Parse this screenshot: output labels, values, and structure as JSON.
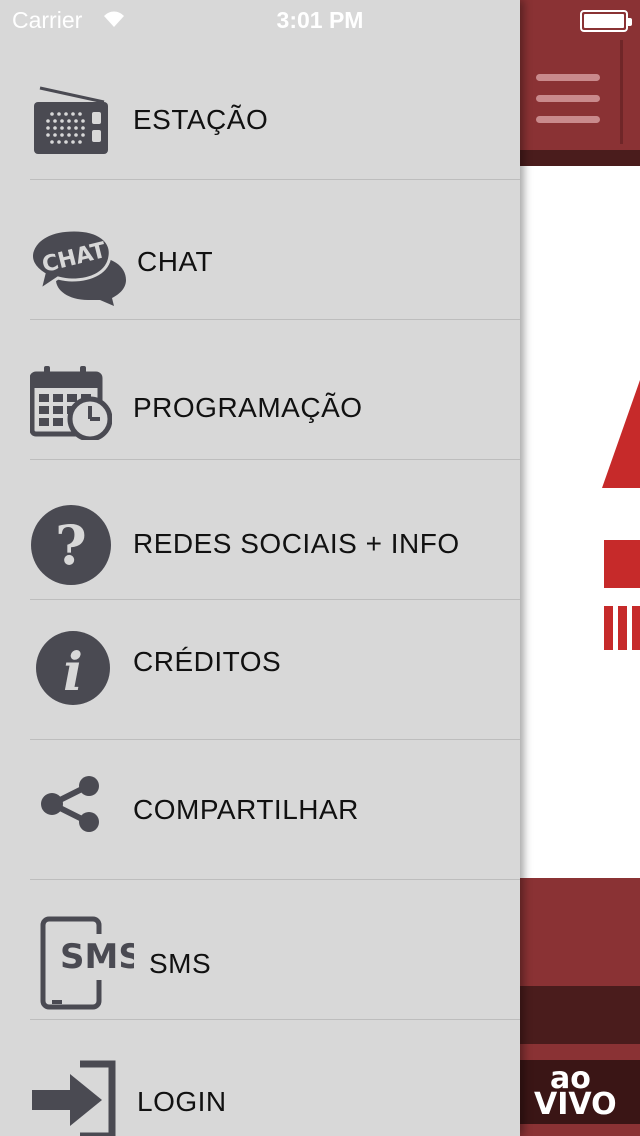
{
  "status_bar": {
    "carrier": "Carrier",
    "time": "3:01 PM"
  },
  "menu": {
    "items": [
      {
        "label": "ESTAÇÃO",
        "icon": "radio-icon"
      },
      {
        "label": "CHAT",
        "icon": "chat-bubble-icon"
      },
      {
        "label": "PROGRAMAÇÃO",
        "icon": "calendar-clock-icon"
      },
      {
        "label": "REDES SOCIAIS + INFO",
        "icon": "question-icon"
      },
      {
        "label": "CRÉDITOS",
        "icon": "info-icon"
      },
      {
        "label": "COMPARTILHAR",
        "icon": "share-icon"
      },
      {
        "label": "SMS",
        "icon": "sms-phone-icon"
      },
      {
        "label": "LOGIN",
        "icon": "login-icon"
      }
    ]
  },
  "background_app": {
    "live_badge_line1": "ao",
    "live_badge_line2": "VIVO"
  },
  "colors": {
    "menu_bg": "#d8d8d8",
    "brand_red": "#8a3234",
    "brand_dark": "#4a1c1c",
    "icon_gray": "#4a4a52",
    "logo_red": "#c62a2a"
  }
}
